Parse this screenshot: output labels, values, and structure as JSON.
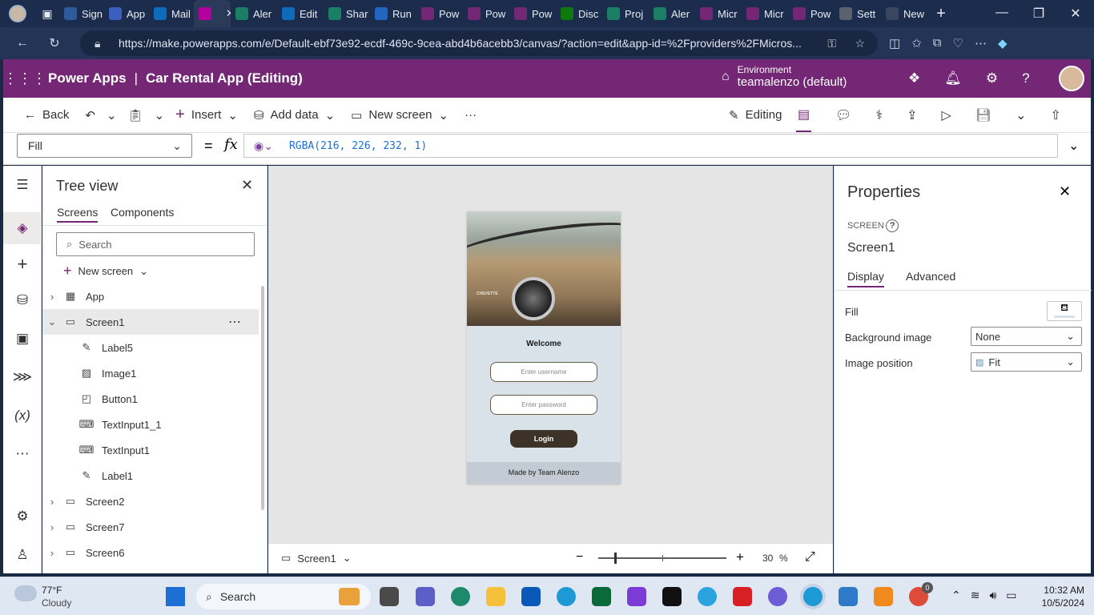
{
  "browser": {
    "tabs": [
      "Sign",
      "App",
      "Mail",
      "",
      "Aler",
      "Edit",
      "Shar",
      "Run",
      "Pow",
      "Pow",
      "Pow",
      "Disc",
      "Proj",
      "Aler",
      "Micr",
      "Micr",
      "Pow",
      "Sett",
      "New"
    ],
    "tab_colors": [
      "#2f5a9b",
      "#3b5fbf",
      "#0f6cbd",
      "#b4009e",
      "#1a7f64",
      "#0f6cbd",
      "#1a7f64",
      "#2266c2",
      "#742774",
      "#742774",
      "#742774",
      "#0e7a0d",
      "#1a7f64",
      "#1a7f64",
      "#742774",
      "#742774",
      "#742774",
      "#5a6270",
      "#3a4660"
    ],
    "url": "https://make.powerapps.com/e/Default-ebf73e92-ecdf-469c-9cea-abd4b6acebb3/canvas/?action=edit&app-id=%2Fproviders%2FMicros..."
  },
  "header": {
    "app_name": "Power Apps",
    "separator": "|",
    "doc_title": "Car Rental App (Editing)",
    "env_label": "Environment",
    "env_name": "teamalenzo (default)"
  },
  "toolbar": {
    "back": "Back",
    "insert": "Insert",
    "add_data": "Add data",
    "new_screen": "New screen",
    "more": "···",
    "editing": "Editing"
  },
  "formula": {
    "property": "Fill",
    "equals": "=",
    "fx": "fx",
    "value": "RGBA(216, 226, 232, 1)"
  },
  "tree": {
    "title": "Tree view",
    "tabs": [
      "Screens",
      "Components"
    ],
    "search_placeholder": "Search",
    "new_screen": "New screen",
    "items": [
      {
        "label": "App",
        "icon": "app-icon"
      },
      {
        "label": "Screen1",
        "icon": "screen-icon"
      },
      {
        "label": "Label5",
        "icon": "label-icon"
      },
      {
        "label": "Image1",
        "icon": "image-icon"
      },
      {
        "label": "Button1",
        "icon": "button-icon"
      },
      {
        "label": "TextInput1_1",
        "icon": "textinput-icon"
      },
      {
        "label": "TextInput1",
        "icon": "textinput-icon"
      },
      {
        "label": "Label1",
        "icon": "label-icon"
      },
      {
        "label": "Screen2",
        "icon": "screen-icon"
      },
      {
        "label": "Screen7",
        "icon": "screen-icon"
      },
      {
        "label": "Screen6",
        "icon": "screen-icon"
      }
    ]
  },
  "app_preview": {
    "welcome": "Welcome",
    "username_placeholder": "Enter username",
    "password_placeholder": "Enter password",
    "login": "Login",
    "footer": "Made by Team Alenzo",
    "badge": "CHEVETTE",
    "bg_color": "#d8e2e8"
  },
  "status": {
    "screen": "Screen1",
    "zoom": "30",
    "zoom_unit": "%"
  },
  "properties": {
    "title": "Properties",
    "type": "SCREEN",
    "name": "Screen1",
    "tabs": [
      "Display",
      "Advanced"
    ],
    "fill_label": "Fill",
    "bg_image_label": "Background image",
    "bg_image_value": "None",
    "img_pos_label": "Image position",
    "img_pos_value": "Fit"
  },
  "taskbar": {
    "temp": "77°F",
    "weather": "Cloudy",
    "search": "Search",
    "time": "10:32 AM",
    "date": "10/5/2024",
    "badge": "0"
  }
}
